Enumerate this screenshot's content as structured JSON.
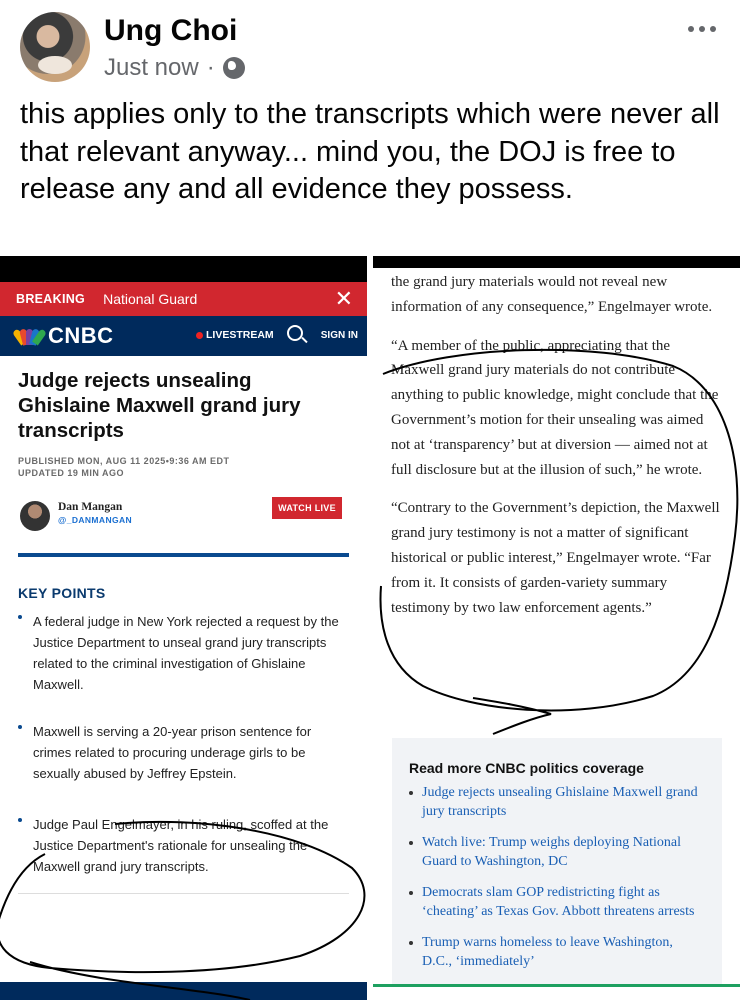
{
  "post": {
    "author": "Ung Choi",
    "timestamp": "Just now",
    "separator": "·",
    "text": "this applies only to the transcripts which were never all that relevant anyway... mind you, the DOJ is free to release any and all evidence they possess."
  },
  "left_screenshot": {
    "breaking_label": "BREAKING",
    "breaking_text": "National Guard",
    "close_symbol": "✕",
    "brand": "CNBC",
    "livestream": "LIVESTREAM",
    "sign_in": "SIGN IN",
    "headline": "Judge rejects unsealing Ghislaine Maxwell grand jury transcripts",
    "published": "PUBLISHED MON, AUG 11 2025•9:36 AM EDT",
    "updated": "UPDATED 19 MIN AGO",
    "author_name": "Dan Mangan",
    "author_handle": "@_DANMANGAN",
    "watch_live": "WATCH LIVE",
    "key_points_title": "KEY POINTS",
    "key_points": [
      "A federal judge in New York rejected a request by the Justice Department to unseal grand jury transcripts related to the criminal investigation of Ghislaine Maxwell.",
      "Maxwell is serving a 20-year prison sentence for crimes related to procuring underage girls to be sexually abused by Jeffrey Epstein.",
      "Judge Paul Engelmayer, in his ruling, scoffed at the Justice Department's rationale for unsealing the Maxwell grand jury transcripts."
    ]
  },
  "right_screenshot": {
    "paragraphs": [
      "the grand jury materials would not reveal new information of any consequence,” Engelmayer wrote.",
      "“A member of the public, appreciating that the Maxwell grand jury materials do not contribute anything to public knowledge, might conclude that the Government’s motion for their unsealing was aimed not at ‘transparency’ but at diversion — aimed not at full disclosure but at the illusion of such,” he wrote.",
      "“Contrary to the Government’s depiction, the Maxwell grand jury testimony is not a matter of significant historical or public interest,” Engelmayer wrote. “Far from it. It consists of garden-variety summary testimony by two law enforcement agents.”"
    ],
    "read_more_title": "Read more CNBC politics coverage",
    "read_more_links": [
      "Judge rejects unsealing Ghislaine Maxwell grand jury transcripts",
      "Watch live: Trump weighs deploying National Guard to Washington, DC",
      "Democrats slam GOP redistricting fight as ‘cheating’ as Texas Gov. Abbott threatens arrests",
      "Trump warns homeless to leave Washington, D.C., ‘immediately’"
    ]
  },
  "colors": {
    "breaking_red": "#d1272f",
    "cnbc_navy": "#002a5c",
    "link_blue": "#1a5fb4",
    "meta_gray": "#65676b"
  },
  "icons": [
    "globe-icon",
    "more-options-icon",
    "close-icon",
    "search-icon",
    "peacock-logo-icon"
  ]
}
